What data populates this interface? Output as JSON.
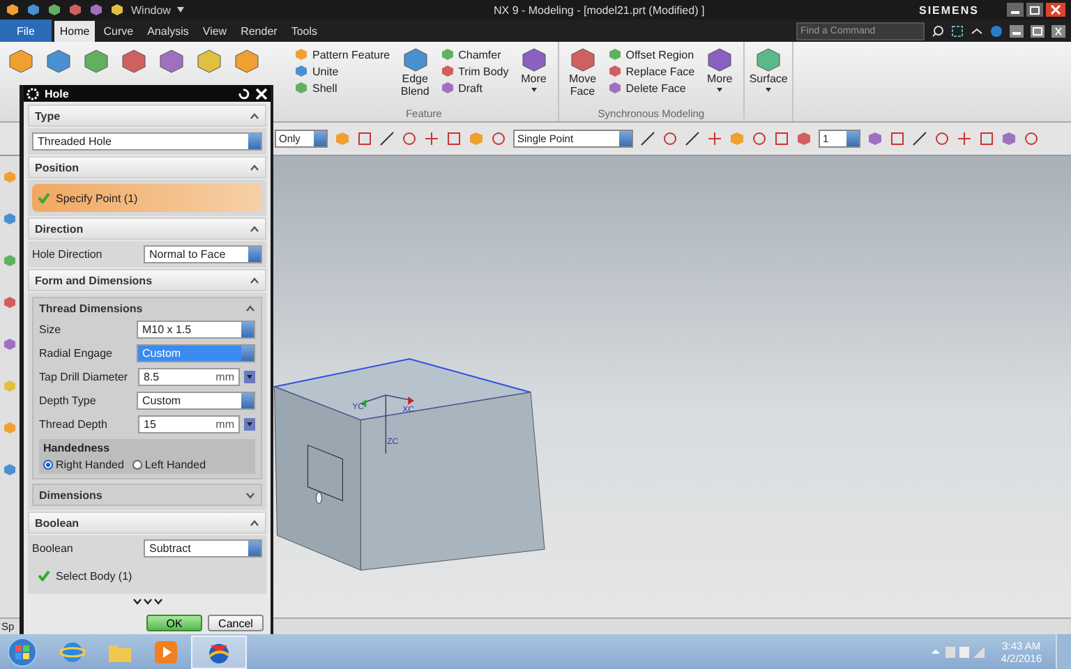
{
  "title_bar": {
    "window_menu": "Window",
    "title": "NX 9 - Modeling - [model21.prt (Modified) ]",
    "brand": "SIEMENS"
  },
  "menu_tabs": [
    {
      "label": "File",
      "kind": "file",
      "selected": false
    },
    {
      "label": "Home",
      "kind": "tab",
      "selected": true
    },
    {
      "label": "Curve",
      "kind": "tab",
      "selected": false
    },
    {
      "label": "Analysis",
      "kind": "tab",
      "selected": false
    },
    {
      "label": "View",
      "kind": "tab",
      "selected": false
    },
    {
      "label": "Render",
      "kind": "tab",
      "selected": false
    },
    {
      "label": "Tools",
      "kind": "tab",
      "selected": false
    }
  ],
  "search": {
    "placeholder": "Find a Command"
  },
  "ribbon": {
    "groups": [
      {
        "label": "Feature",
        "columns": [
          {
            "kind": "stack",
            "items": [
              "Pattern Feature",
              "Unite",
              "Shell"
            ]
          },
          {
            "kind": "large",
            "label": "Edge Blend"
          },
          {
            "kind": "stack",
            "items": [
              "Chamfer",
              "Trim Body",
              "Draft"
            ]
          },
          {
            "kind": "more",
            "label": "More"
          }
        ]
      },
      {
        "label": "Synchronous Modeling",
        "columns": [
          {
            "kind": "large",
            "label": "Move Face"
          },
          {
            "kind": "stack",
            "items": [
              "Offset Region",
              "Replace Face",
              "Delete Face"
            ]
          },
          {
            "kind": "more",
            "label": "More"
          }
        ]
      },
      {
        "columns": [
          {
            "kind": "more",
            "label": "Surface"
          }
        ]
      }
    ]
  },
  "toolbar": {
    "filter": "Only",
    "snap_point": "Single Point",
    "layer": "1"
  },
  "dialog": {
    "title": "Hole",
    "sections": [
      {
        "title": "Type",
        "expanded": true,
        "rows": [
          {
            "kind": "dropdown",
            "value": "Threaded Hole",
            "highlighted": false
          }
        ]
      },
      {
        "title": "Position",
        "expanded": true,
        "rows": [
          {
            "kind": "select",
            "label": "Specify Point (1)",
            "active": true
          }
        ]
      },
      {
        "title": "Direction",
        "expanded": true,
        "rows": [
          {
            "kind": "dropdown",
            "label": "Hole Direction",
            "value": "Normal to Face",
            "highlighted": false
          }
        ]
      },
      {
        "title": "Form and Dimensions",
        "expanded": true,
        "rows": [
          {
            "kind": "subsection",
            "title": "Thread Dimensions",
            "expanded": true,
            "rows": [
              {
                "kind": "dropdown",
                "label": "Size",
                "value": "M10 x 1.5",
                "highlighted": false
              },
              {
                "kind": "dropdown",
                "label": "Radial Engage",
                "value": "Custom",
                "highlighted": true
              },
              {
                "kind": "field",
                "label": "Tap Drill Diameter",
                "value": "8.5",
                "unit": "mm"
              },
              {
                "kind": "dropdown",
                "label": "Depth Type",
                "value": "Custom",
                "highlighted": false
              },
              {
                "kind": "field",
                "label": "Thread Depth",
                "value": "15",
                "unit": "mm"
              },
              {
                "kind": "radio",
                "title": "Handedness",
                "options": [
                  {
                    "label": "Right Handed",
                    "selected": true
                  },
                  {
                    "label": "Left Handed",
                    "selected": false
                  }
                ]
              }
            ]
          },
          {
            "kind": "subsection",
            "title": "Dimensions",
            "expanded": false
          }
        ]
      },
      {
        "title": "Boolean",
        "expanded": true,
        "rows": [
          {
            "kind": "dropdown",
            "label": "Boolean",
            "value": "Subtract",
            "highlighted": false
          },
          {
            "kind": "select",
            "label": "Select Body (1)",
            "active": false
          }
        ]
      }
    ],
    "buttons": [
      {
        "label": "OK",
        "default": true
      },
      {
        "label": "Cancel",
        "default": false
      }
    ]
  },
  "viewport": {
    "axis_labels": [
      "YC",
      "XC",
      "ZC"
    ]
  },
  "status_bar": {
    "text": "Sp"
  },
  "taskbar": {
    "time": "3:43 AM",
    "date": "4/2/2016"
  }
}
